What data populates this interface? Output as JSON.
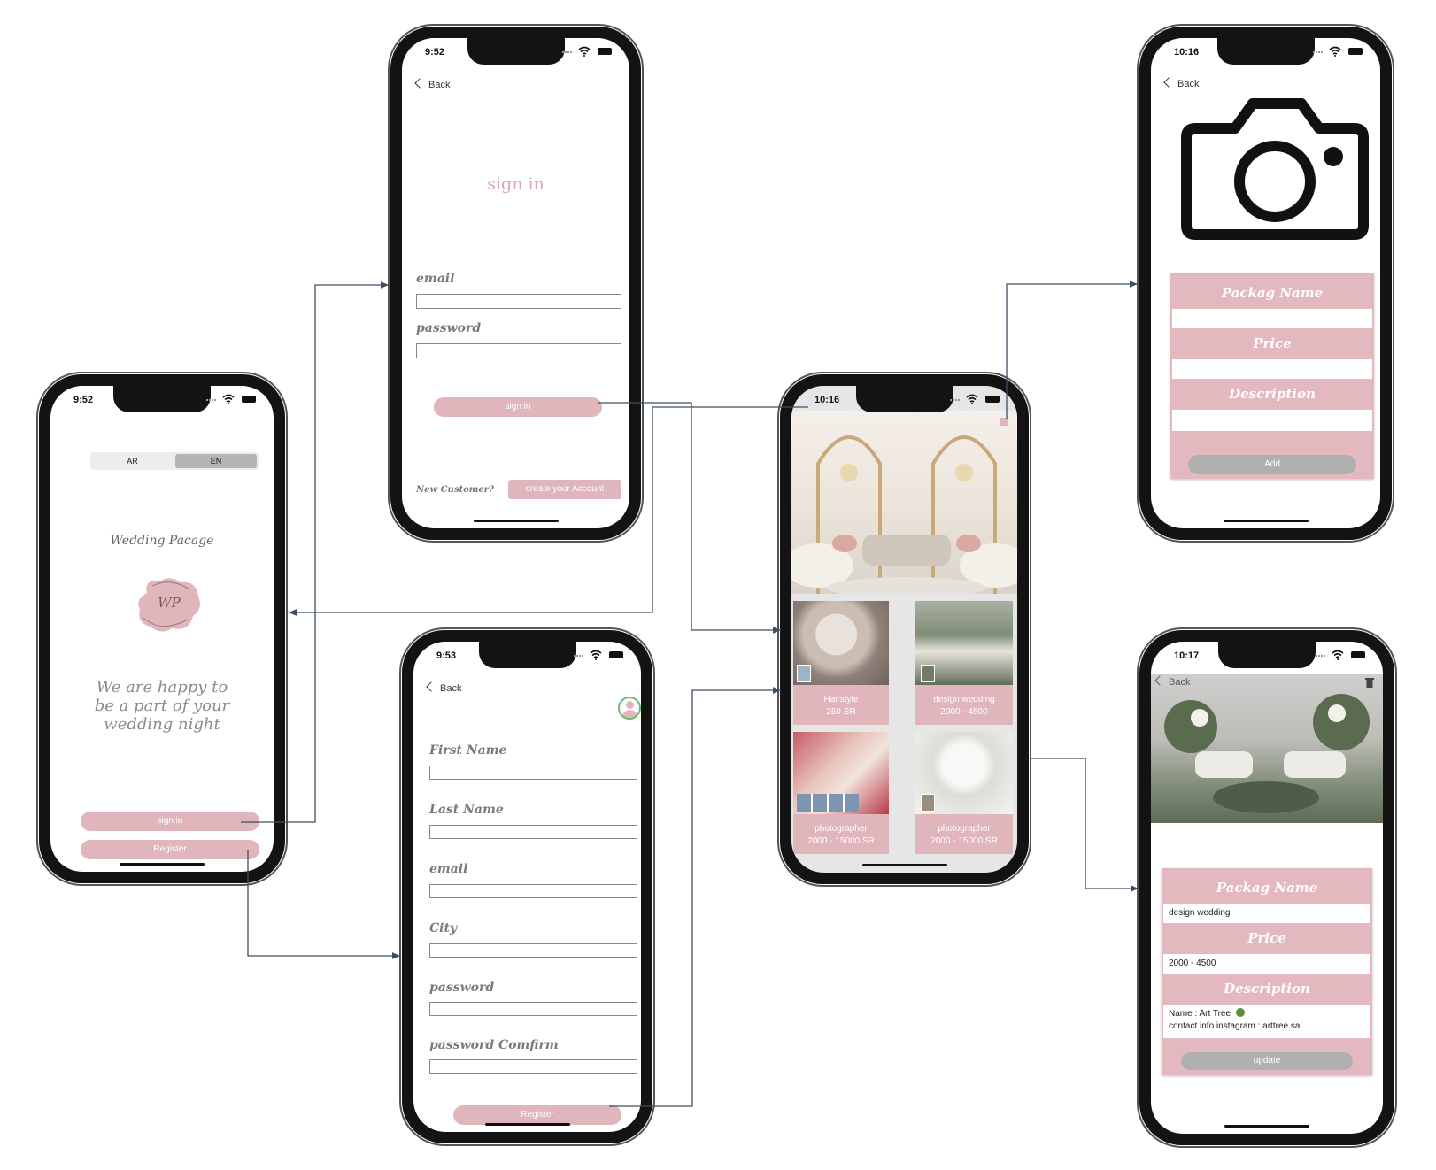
{
  "welcome": {
    "time": "9:52",
    "lang_ar": "AR",
    "lang_en": "EN",
    "brand": "Wedding Pacage",
    "logo_text": "WP",
    "tagline": "We are happy to be a part of your wedding night",
    "signin_label": "sign in",
    "register_label": "Register"
  },
  "signin": {
    "time": "9:52",
    "back_label": "Back",
    "title": "sign in",
    "email_label": "email",
    "password_label": "password",
    "signin_button": "sign in",
    "new_customer": "New Customer?",
    "create_account_button": "create your Account"
  },
  "register": {
    "time": "9:53",
    "back_label": "Back",
    "first_name_label": "First Name",
    "last_name_label": "Last Name",
    "email_label": "email",
    "city_label": "City",
    "password_label": "password",
    "password_confirm_label": "password Comfirm",
    "register_button": "Register"
  },
  "home": {
    "time": "10:16",
    "tiles": [
      {
        "name": "Hairstyle",
        "price": "250 SR"
      },
      {
        "name": "design wedding",
        "price": "2000 - 4500"
      },
      {
        "name": "photographer",
        "price": "2000 - 15000 SR"
      },
      {
        "name": "photographer",
        "price": "2000 - 15000 SR"
      }
    ]
  },
  "add_package": {
    "time": "10:16",
    "back_label": "Back",
    "name_label": "Packag Name",
    "price_label": "Price",
    "description_label": "Description",
    "add_button": "Add"
  },
  "edit_package": {
    "time": "10:17",
    "back_label": "Back",
    "name_label": "Packag Name",
    "name_value": "design wedding",
    "price_label": "Price",
    "price_value": "2000 - 4500",
    "description_label": "Description",
    "description_line1": "Name : Art Tree",
    "description_line2": "contact info instagram : arttree.sa",
    "update_button": "update"
  },
  "colors": {
    "accent_pink": "#e0b5bc",
    "button_gray": "#b0b0b0",
    "connector": "#3d4f60"
  }
}
